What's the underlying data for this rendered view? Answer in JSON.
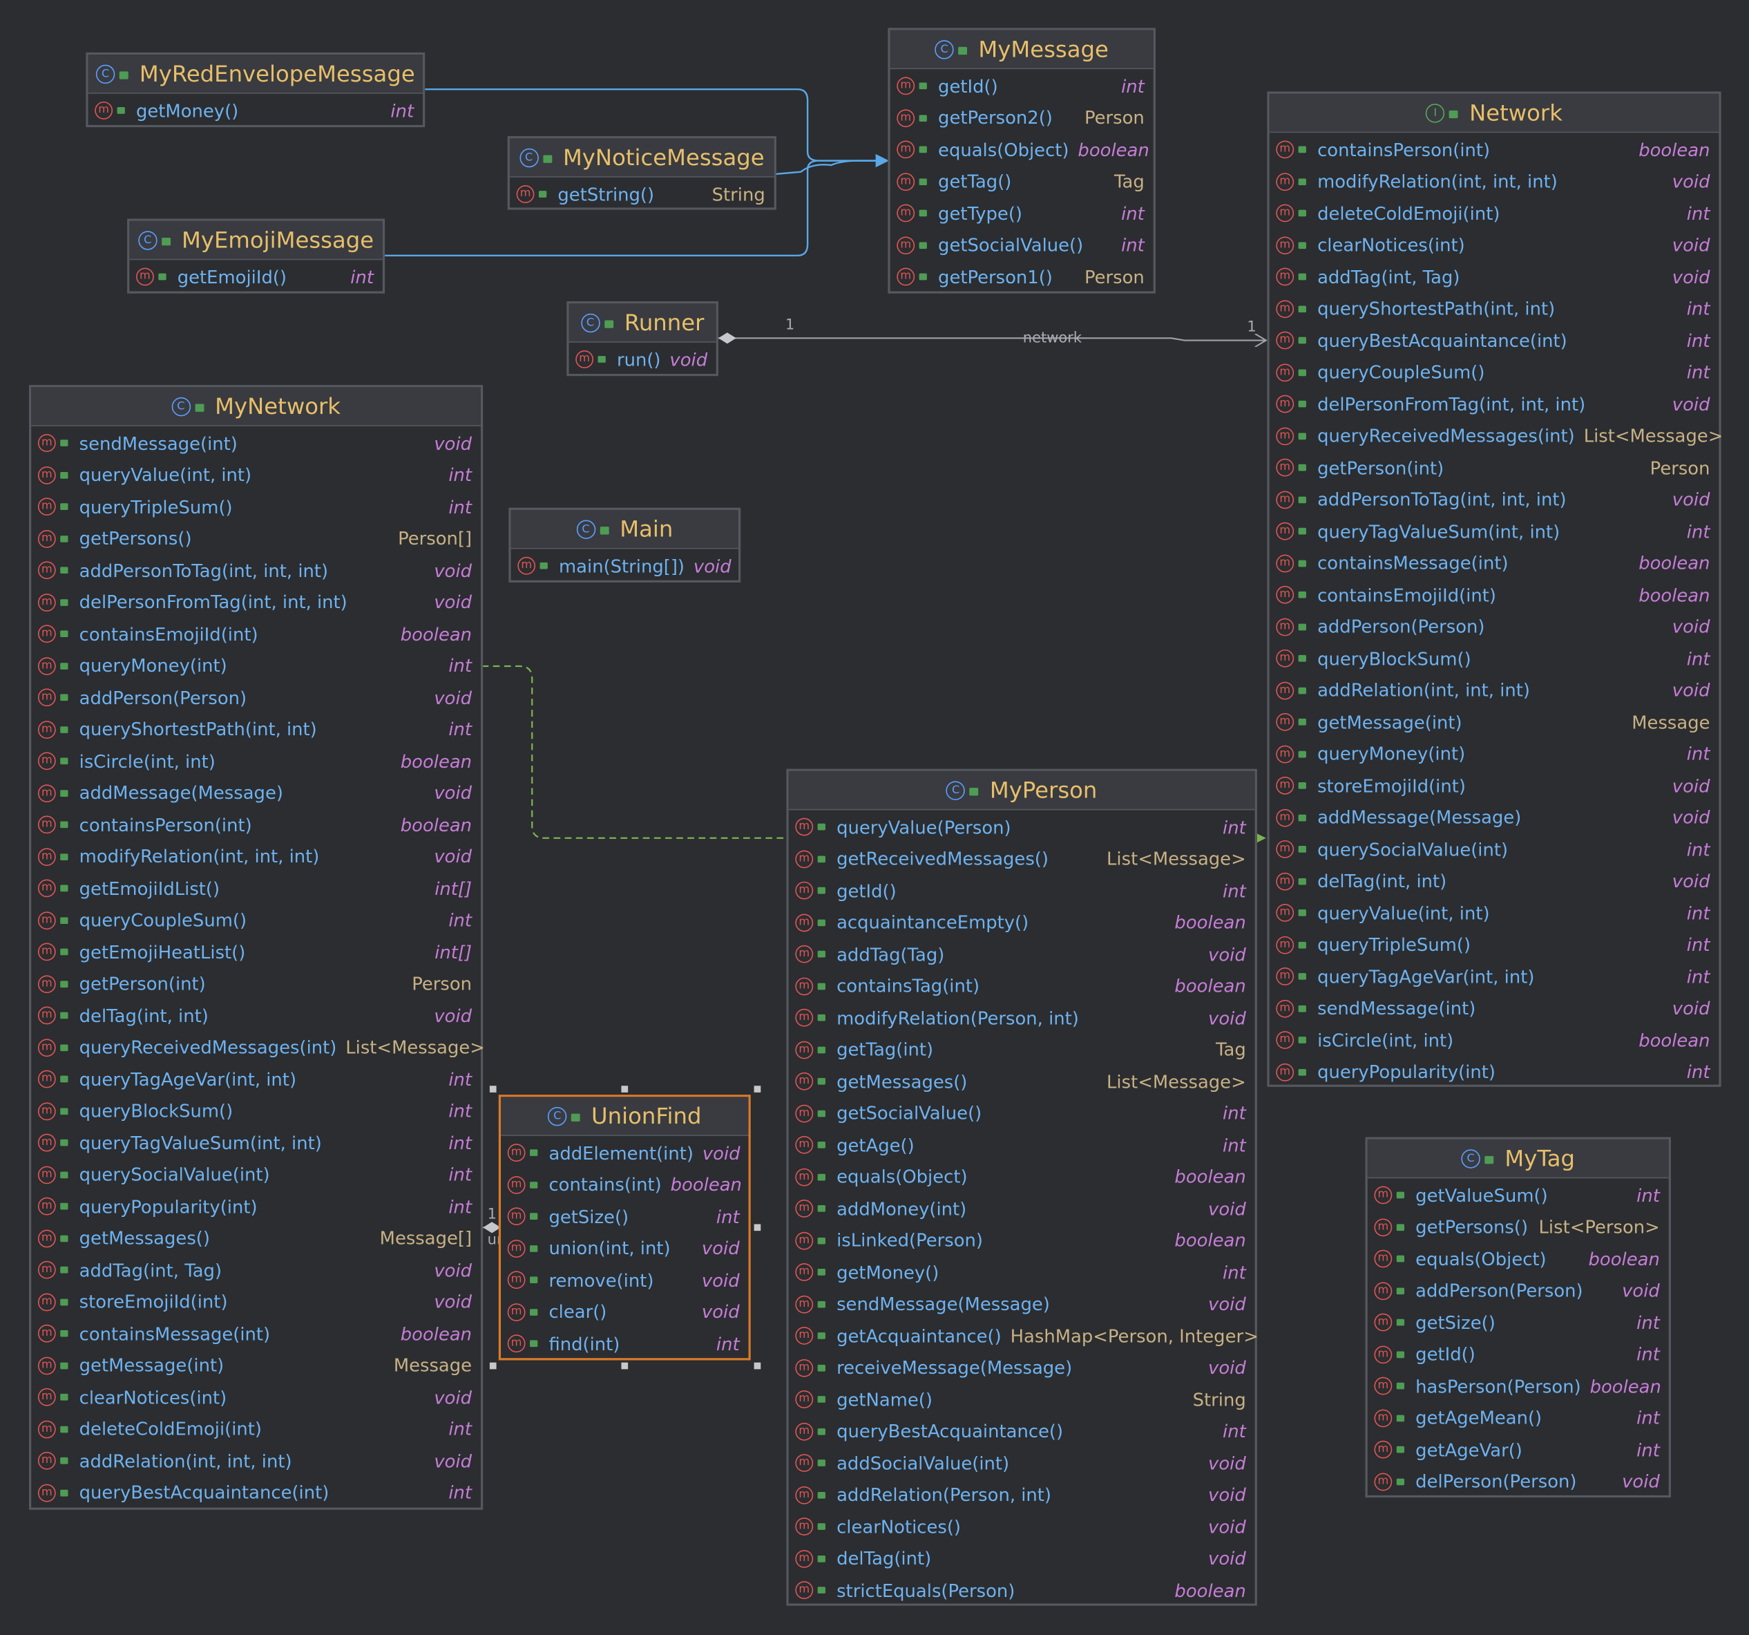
{
  "colors": {
    "background": "#2b2d30",
    "header": "#393b40",
    "class_name": "#e8bf6a",
    "method": "#6fb2f0",
    "primitive_type": "#c77dd8",
    "object_type": "#c8b185",
    "border": "#55585e",
    "selected_border": "#d97a2a",
    "implements_link": "#5aa8e8",
    "dependency_link": "#7fb24f",
    "association_link": "#9ea3a8"
  },
  "class_icon": "C",
  "interface_icon": "I",
  "method_icon": "m",
  "classes": [
    {
      "id": "myredenvelopemessage",
      "name": "MyRedEnvelopeMessage",
      "kind": "class",
      "methods": [
        {
          "sig": "getMoney()",
          "type": "int"
        }
      ]
    },
    {
      "id": "mynoticemessage",
      "name": "MyNoticeMessage",
      "kind": "class",
      "methods": [
        {
          "sig": "getString()",
          "type": "String"
        }
      ]
    },
    {
      "id": "myemojimessage",
      "name": "MyEmojiMessage",
      "kind": "class",
      "methods": [
        {
          "sig": "getEmojiId()",
          "type": "int"
        }
      ]
    },
    {
      "id": "mymessage",
      "name": "MyMessage",
      "kind": "class",
      "methods": [
        {
          "sig": "getId()",
          "type": "int"
        },
        {
          "sig": "getPerson2()",
          "type": "Person"
        },
        {
          "sig": "equals(Object)",
          "type": "boolean"
        },
        {
          "sig": "getTag()",
          "type": "Tag"
        },
        {
          "sig": "getType()",
          "type": "int"
        },
        {
          "sig": "getSocialValue()",
          "type": "int"
        },
        {
          "sig": "getPerson1()",
          "type": "Person"
        }
      ]
    },
    {
      "id": "network",
      "name": "Network",
      "kind": "interface",
      "methods": [
        {
          "sig": "containsPerson(int)",
          "type": "boolean"
        },
        {
          "sig": "modifyRelation(int, int, int)",
          "type": "void"
        },
        {
          "sig": "deleteColdEmoji(int)",
          "type": "int"
        },
        {
          "sig": "clearNotices(int)",
          "type": "void"
        },
        {
          "sig": "addTag(int, Tag)",
          "type": "void"
        },
        {
          "sig": "queryShortestPath(int, int)",
          "type": "int"
        },
        {
          "sig": "queryBestAcquaintance(int)",
          "type": "int"
        },
        {
          "sig": "queryCoupleSum()",
          "type": "int"
        },
        {
          "sig": "delPersonFromTag(int, int, int)",
          "type": "void"
        },
        {
          "sig": "queryReceivedMessages(int)",
          "type": "List<Message>"
        },
        {
          "sig": "getPerson(int)",
          "type": "Person"
        },
        {
          "sig": "addPersonToTag(int, int, int)",
          "type": "void"
        },
        {
          "sig": "queryTagValueSum(int, int)",
          "type": "int"
        },
        {
          "sig": "containsMessage(int)",
          "type": "boolean"
        },
        {
          "sig": "containsEmojiId(int)",
          "type": "boolean"
        },
        {
          "sig": "addPerson(Person)",
          "type": "void"
        },
        {
          "sig": "queryBlockSum()",
          "type": "int"
        },
        {
          "sig": "addRelation(int, int, int)",
          "type": "void"
        },
        {
          "sig": "getMessage(int)",
          "type": "Message"
        },
        {
          "sig": "queryMoney(int)",
          "type": "int"
        },
        {
          "sig": "storeEmojiId(int)",
          "type": "void"
        },
        {
          "sig": "addMessage(Message)",
          "type": "void"
        },
        {
          "sig": "querySocialValue(int)",
          "type": "int"
        },
        {
          "sig": "delTag(int, int)",
          "type": "void"
        },
        {
          "sig": "queryValue(int, int)",
          "type": "int"
        },
        {
          "sig": "queryTripleSum()",
          "type": "int"
        },
        {
          "sig": "queryTagAgeVar(int, int)",
          "type": "int"
        },
        {
          "sig": "sendMessage(int)",
          "type": "void"
        },
        {
          "sig": "isCircle(int, int)",
          "type": "boolean"
        },
        {
          "sig": "queryPopularity(int)",
          "type": "int"
        }
      ]
    },
    {
      "id": "runner",
      "name": "Runner",
      "kind": "class",
      "methods": [
        {
          "sig": "run()",
          "type": "void"
        }
      ]
    },
    {
      "id": "main",
      "name": "Main",
      "kind": "class",
      "methods": [
        {
          "sig": "main(String[])",
          "type": "void"
        }
      ]
    },
    {
      "id": "mynetwork",
      "name": "MyNetwork",
      "kind": "class",
      "methods": [
        {
          "sig": "sendMessage(int)",
          "type": "void"
        },
        {
          "sig": "queryValue(int, int)",
          "type": "int"
        },
        {
          "sig": "queryTripleSum()",
          "type": "int"
        },
        {
          "sig": "getPersons()",
          "type": "Person[]"
        },
        {
          "sig": "addPersonToTag(int, int, int)",
          "type": "void"
        },
        {
          "sig": "delPersonFromTag(int, int, int)",
          "type": "void"
        },
        {
          "sig": "containsEmojiId(int)",
          "type": "boolean"
        },
        {
          "sig": "queryMoney(int)",
          "type": "int"
        },
        {
          "sig": "addPerson(Person)",
          "type": "void"
        },
        {
          "sig": "queryShortestPath(int, int)",
          "type": "int"
        },
        {
          "sig": "isCircle(int, int)",
          "type": "boolean"
        },
        {
          "sig": "addMessage(Message)",
          "type": "void"
        },
        {
          "sig": "containsPerson(int)",
          "type": "boolean"
        },
        {
          "sig": "modifyRelation(int, int, int)",
          "type": "void"
        },
        {
          "sig": "getEmojiIdList()",
          "type": "int[]"
        },
        {
          "sig": "queryCoupleSum()",
          "type": "int"
        },
        {
          "sig": "getEmojiHeatList()",
          "type": "int[]"
        },
        {
          "sig": "getPerson(int)",
          "type": "Person"
        },
        {
          "sig": "delTag(int, int)",
          "type": "void"
        },
        {
          "sig": "queryReceivedMessages(int)",
          "type": "List<Message>"
        },
        {
          "sig": "queryTagAgeVar(int, int)",
          "type": "int"
        },
        {
          "sig": "queryBlockSum()",
          "type": "int"
        },
        {
          "sig": "queryTagValueSum(int, int)",
          "type": "int"
        },
        {
          "sig": "querySocialValue(int)",
          "type": "int"
        },
        {
          "sig": "queryPopularity(int)",
          "type": "int"
        },
        {
          "sig": "getMessages()",
          "type": "Message[]"
        },
        {
          "sig": "addTag(int, Tag)",
          "type": "void"
        },
        {
          "sig": "storeEmojiId(int)",
          "type": "void"
        },
        {
          "sig": "containsMessage(int)",
          "type": "boolean"
        },
        {
          "sig": "getMessage(int)",
          "type": "Message"
        },
        {
          "sig": "clearNotices(int)",
          "type": "void"
        },
        {
          "sig": "deleteColdEmoji(int)",
          "type": "int"
        },
        {
          "sig": "addRelation(int, int, int)",
          "type": "void"
        },
        {
          "sig": "queryBestAcquaintance(int)",
          "type": "int"
        }
      ]
    },
    {
      "id": "unionfind",
      "name": "UnionFind",
      "kind": "class",
      "methods": [
        {
          "sig": "addElement(int)",
          "type": "void"
        },
        {
          "sig": "contains(int)",
          "type": "boolean"
        },
        {
          "sig": "getSize()",
          "type": "int"
        },
        {
          "sig": "union(int, int)",
          "type": "void"
        },
        {
          "sig": "remove(int)",
          "type": "void"
        },
        {
          "sig": "clear()",
          "type": "void"
        },
        {
          "sig": "find(int)",
          "type": "int"
        }
      ]
    },
    {
      "id": "myperson",
      "name": "MyPerson",
      "kind": "class",
      "methods": [
        {
          "sig": "queryValue(Person)",
          "type": "int"
        },
        {
          "sig": "getReceivedMessages()",
          "type": "List<Message>"
        },
        {
          "sig": "getId()",
          "type": "int"
        },
        {
          "sig": "acquaintanceEmpty()",
          "type": "boolean"
        },
        {
          "sig": "addTag(Tag)",
          "type": "void"
        },
        {
          "sig": "containsTag(int)",
          "type": "boolean"
        },
        {
          "sig": "modifyRelation(Person, int)",
          "type": "void"
        },
        {
          "sig": "getTag(int)",
          "type": "Tag"
        },
        {
          "sig": "getMessages()",
          "type": "List<Message>"
        },
        {
          "sig": "getSocialValue()",
          "type": "int"
        },
        {
          "sig": "getAge()",
          "type": "int"
        },
        {
          "sig": "equals(Object)",
          "type": "boolean"
        },
        {
          "sig": "addMoney(int)",
          "type": "void"
        },
        {
          "sig": "isLinked(Person)",
          "type": "boolean"
        },
        {
          "sig": "getMoney()",
          "type": "int"
        },
        {
          "sig": "sendMessage(Message)",
          "type": "void"
        },
        {
          "sig": "getAcquaintance()",
          "type": "HashMap<Person, Integer>"
        },
        {
          "sig": "receiveMessage(Message)",
          "type": "void"
        },
        {
          "sig": "getName()",
          "type": "String"
        },
        {
          "sig": "queryBestAcquaintance()",
          "type": "int"
        },
        {
          "sig": "addSocialValue(int)",
          "type": "void"
        },
        {
          "sig": "addRelation(Person, int)",
          "type": "void"
        },
        {
          "sig": "clearNotices()",
          "type": "void"
        },
        {
          "sig": "delTag(int)",
          "type": "void"
        },
        {
          "sig": "strictEquals(Person)",
          "type": "boolean"
        }
      ]
    },
    {
      "id": "mytag",
      "name": "MyTag",
      "kind": "class",
      "methods": [
        {
          "sig": "getValueSum()",
          "type": "int"
        },
        {
          "sig": "getPersons()",
          "type": "List<Person>"
        },
        {
          "sig": "equals(Object)",
          "type": "boolean"
        },
        {
          "sig": "addPerson(Person)",
          "type": "void"
        },
        {
          "sig": "getSize()",
          "type": "int"
        },
        {
          "sig": "getId()",
          "type": "int"
        },
        {
          "sig": "hasPerson(Person)",
          "type": "boolean"
        },
        {
          "sig": "getAgeMean()",
          "type": "int"
        },
        {
          "sig": "getAgeVar()",
          "type": "int"
        },
        {
          "sig": "delPerson(Person)",
          "type": "void"
        }
      ]
    }
  ],
  "links": {
    "runner_network": {
      "from": "Runner",
      "to": "Network",
      "label": "network",
      "from_mult": "1",
      "to_mult": "1"
    },
    "mynetwork_unionfind": {
      "from": "MyNetwork",
      "to": "UnionFind",
      "label": "unionFind",
      "mult": "1"
    }
  }
}
